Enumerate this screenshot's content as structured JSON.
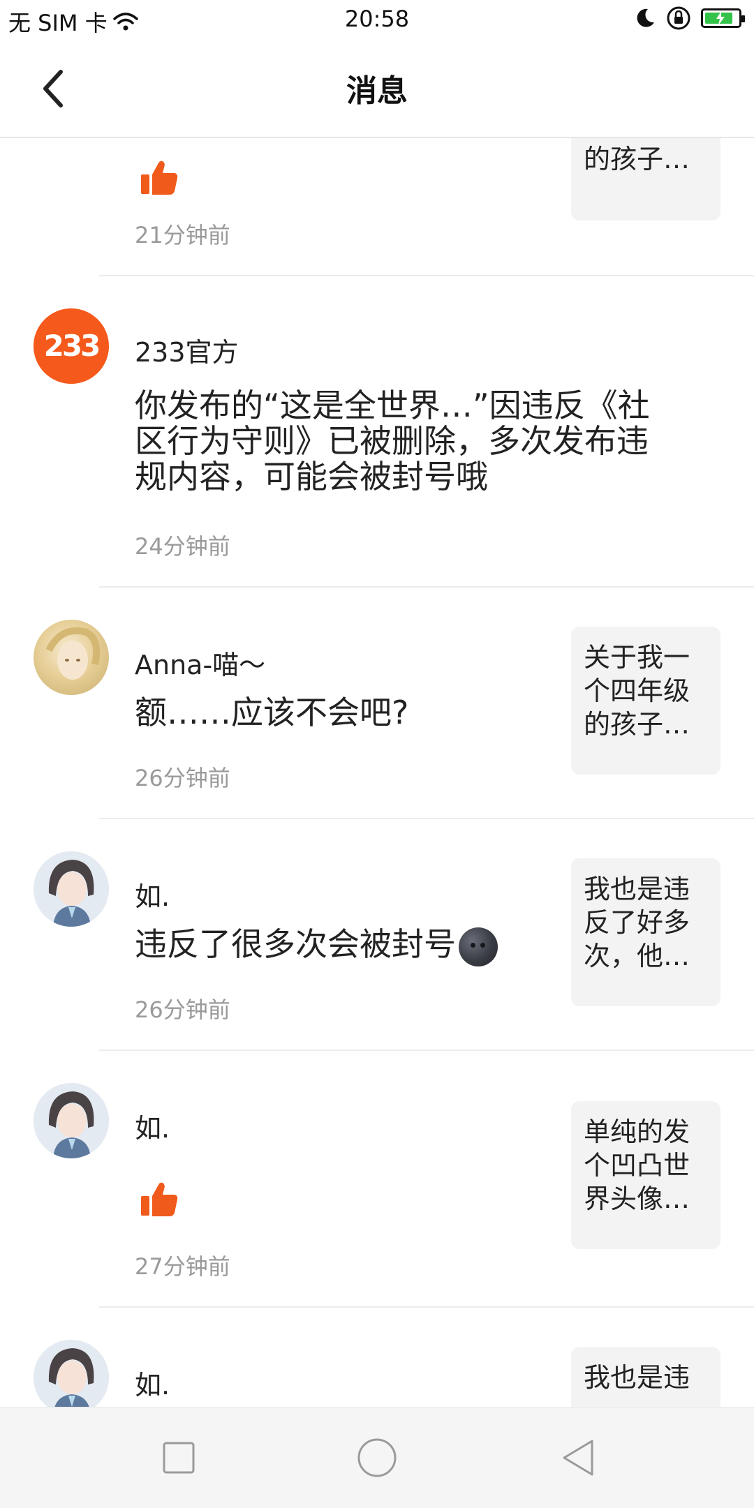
{
  "status": {
    "carrier": "无 SIM 卡",
    "time": "20:58",
    "battery_level": 0.75,
    "colors": {
      "battery": "#33c24a"
    }
  },
  "header": {
    "title": "消息"
  },
  "colors": {
    "accent": "#f05a1a"
  },
  "messages": [
    {
      "content_type": "like",
      "time": "21分钟前",
      "ref": "个四年级的孩子…"
    },
    {
      "sender": "233官方",
      "avatar": "233-logo",
      "content": "你发布的“这是全世界…”因违反《社区行为守则》已被删除，多次发布违规内容，可能会被封号哦",
      "time": "24分钟前"
    },
    {
      "sender": "Anna-喵〜",
      "avatar": "anna-avatar",
      "content": "额……应该不会吧?",
      "time": "26分钟前",
      "ref": "关于我一个四年级的孩子…"
    },
    {
      "sender": "如.",
      "avatar": "girl-avatar",
      "content": "违反了很多次会被封号",
      "emoji": "new-moon-face",
      "time": "26分钟前",
      "ref": "我也是违反了好多次，他…"
    },
    {
      "sender": "如.",
      "avatar": "girl-avatar",
      "content_type": "like",
      "time": "27分钟前",
      "ref": "单纯的发个凹凸世界头像…"
    },
    {
      "sender": "如.",
      "avatar": "girl-avatar",
      "ref": "我也是违"
    }
  ],
  "navbar": {
    "items": [
      "recent-apps",
      "home",
      "back"
    ]
  }
}
